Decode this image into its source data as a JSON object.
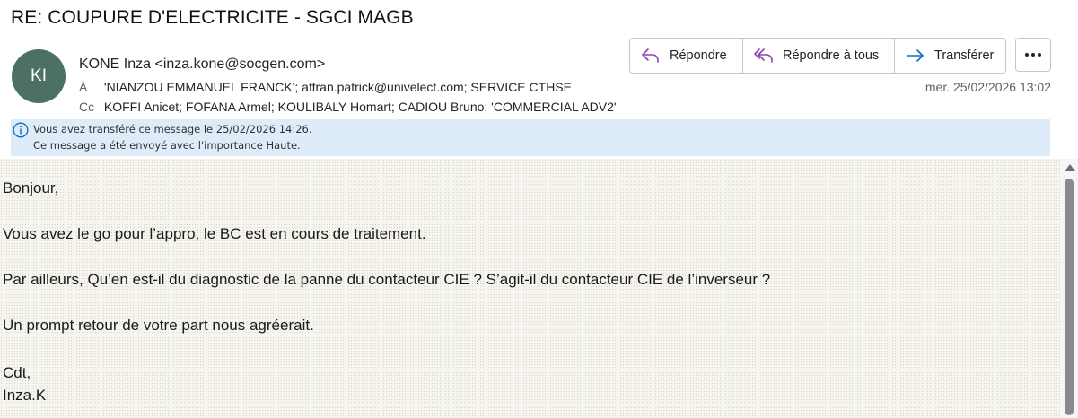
{
  "message": {
    "subject": "RE: COUPURE D'ELECTRICITE - SGCI MAGB",
    "avatar_initials": "KI",
    "avatar_color": "#4c7163",
    "sender": "KONE Inza <inza.kone@socgen.com>",
    "to_label": "À",
    "to": "'NIANZOU EMMANUEL FRANCK'; affran.patrick@univelect.com; SERVICE CTHSE",
    "cc_label": "Cc",
    "cc": "KOFFI Anicet; FOFANA Armel; KOULIBALY Homart; CADIOU Bruno; 'COMMERCIAL ADV2'",
    "date": "mer. 25/02/2026 13:02"
  },
  "actions": {
    "reply_label": "Répondre",
    "reply_all_label": "Répondre à tous",
    "forward_label": "Transférer",
    "accent_color": "#0f6cbd",
    "reply_icon_color": "#8e44ad"
  },
  "info_bar": {
    "line1": "Vous avez transféré ce message le 25/02/2026 14:26.",
    "line2": "Ce message a été envoyé avec l'importance Haute."
  },
  "body": {
    "greeting": "Bonjour,",
    "line1": "Vous avez le go pour l’appro, le BC est en cours de traitement.",
    "line2": "Par ailleurs, Qu’en est-il du diagnostic de la panne du contacteur CIE ? S’agit-il du contacteur CIE de l’inverseur ?",
    "line3": "Un prompt retour de votre part nous agréerait.",
    "closing": "Cdt,",
    "signature": "Inza.K"
  }
}
